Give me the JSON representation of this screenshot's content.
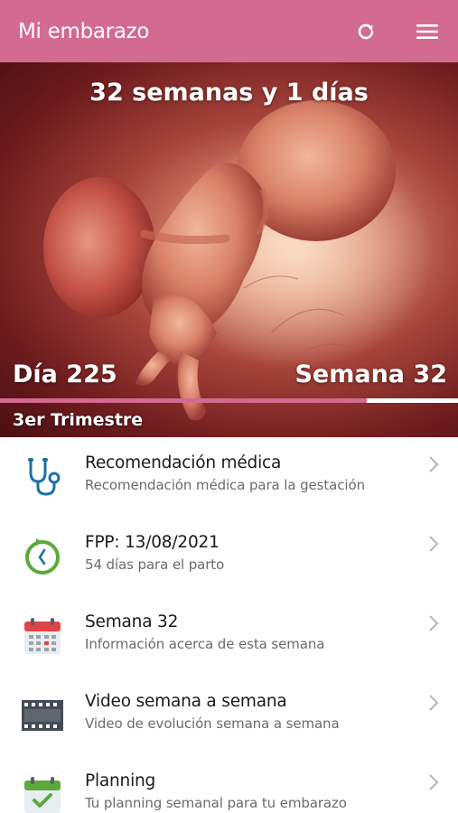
{
  "header": {
    "title": "Mi embarazo",
    "refresh_icon": "refresh-icon",
    "menu_icon": "hamburger-menu-icon",
    "accent_color": "#d36a8f"
  },
  "hero": {
    "gestation_text": "32 semanas y 1 días",
    "day_text": "Día 225",
    "week_text": "Semana 32",
    "trimester_text": "3er Trimestre",
    "progress_fraction": 0.8
  },
  "menu": [
    {
      "title": "Recomendación médica",
      "subtitle": "Recomendación médica para la gestación",
      "icon": "stethoscope-icon"
    },
    {
      "title": "FPP: 13/08/2021",
      "subtitle": "54 días para el parto",
      "icon": "clock-countdown-icon"
    },
    {
      "title": "Semana 32",
      "subtitle": "Información acerca de esta semana",
      "icon": "calendar-icon"
    },
    {
      "title": "Video semana a semana",
      "subtitle": "Video de evolución semana a semana",
      "icon": "film-icon"
    },
    {
      "title": "Planning",
      "subtitle": "Tu planning semanal para tu embarazo",
      "icon": "calendar-check-icon"
    }
  ]
}
